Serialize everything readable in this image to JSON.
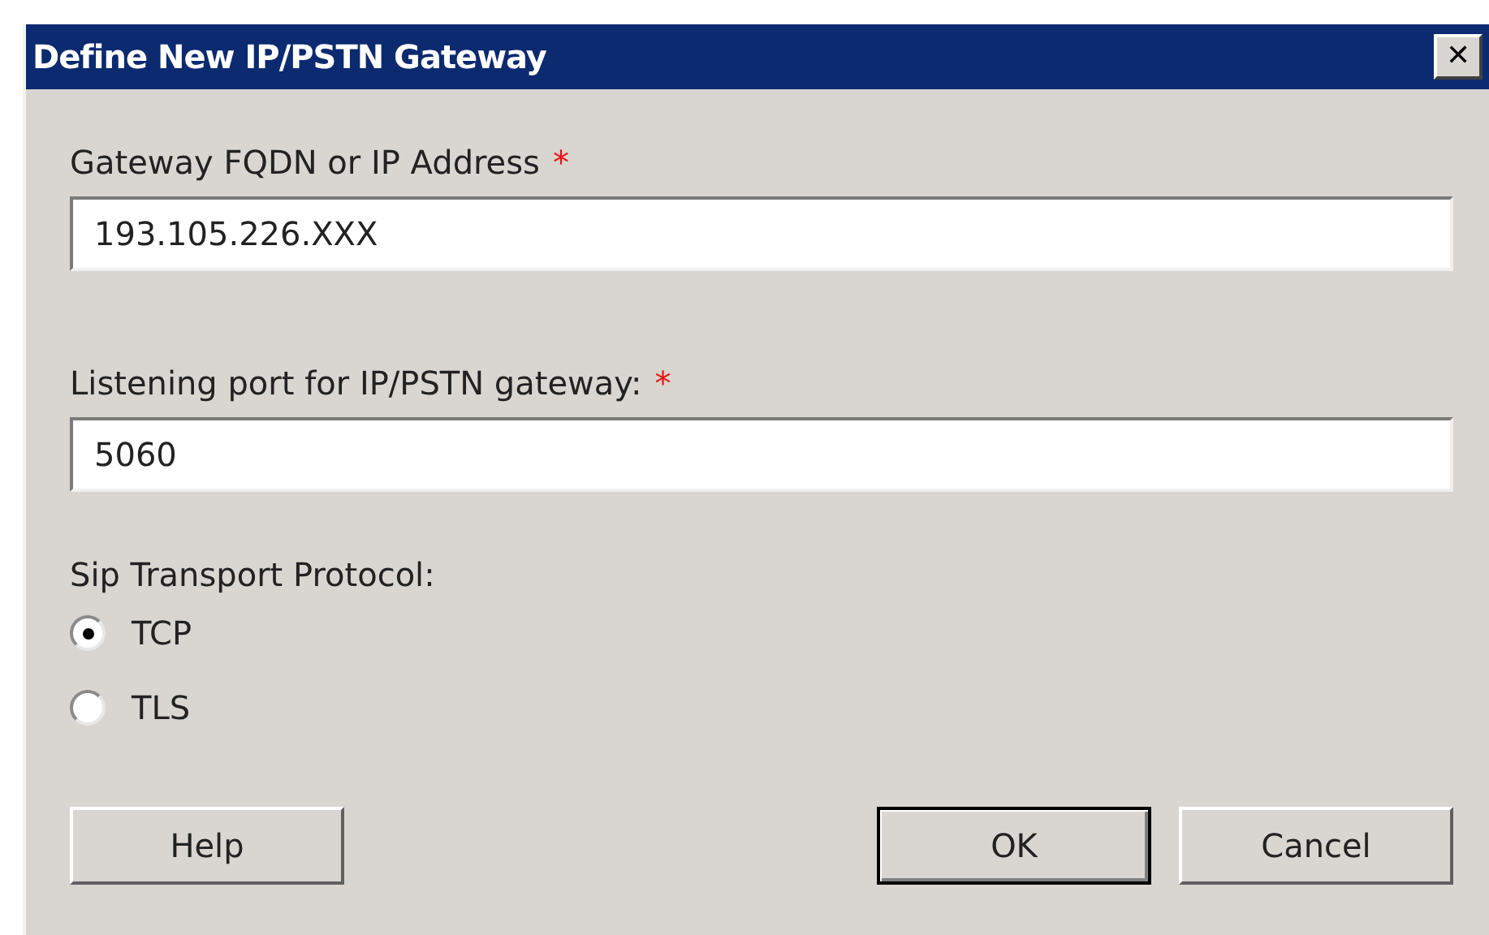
{
  "window": {
    "title": "Define New IP/PSTN Gateway",
    "close": "✕"
  },
  "fields": [
    {
      "label": "Gateway FQDN or IP Address",
      "required_mark": "*",
      "value": "193.105.226.XXX"
    },
    {
      "label": "Listening port for IP/PSTN gateway:",
      "required_mark": "*",
      "value": "5060"
    }
  ],
  "protocol": {
    "label": "Sip Transport Protocol:",
    "options": [
      {
        "label": "TCP",
        "selected": true
      },
      {
        "label": "TLS",
        "selected": false
      }
    ]
  },
  "buttons": {
    "left": [
      {
        "label": "Help",
        "default": false
      }
    ],
    "right": [
      {
        "label": "OK",
        "default": true
      },
      {
        "label": "Cancel",
        "default": false
      }
    ]
  }
}
